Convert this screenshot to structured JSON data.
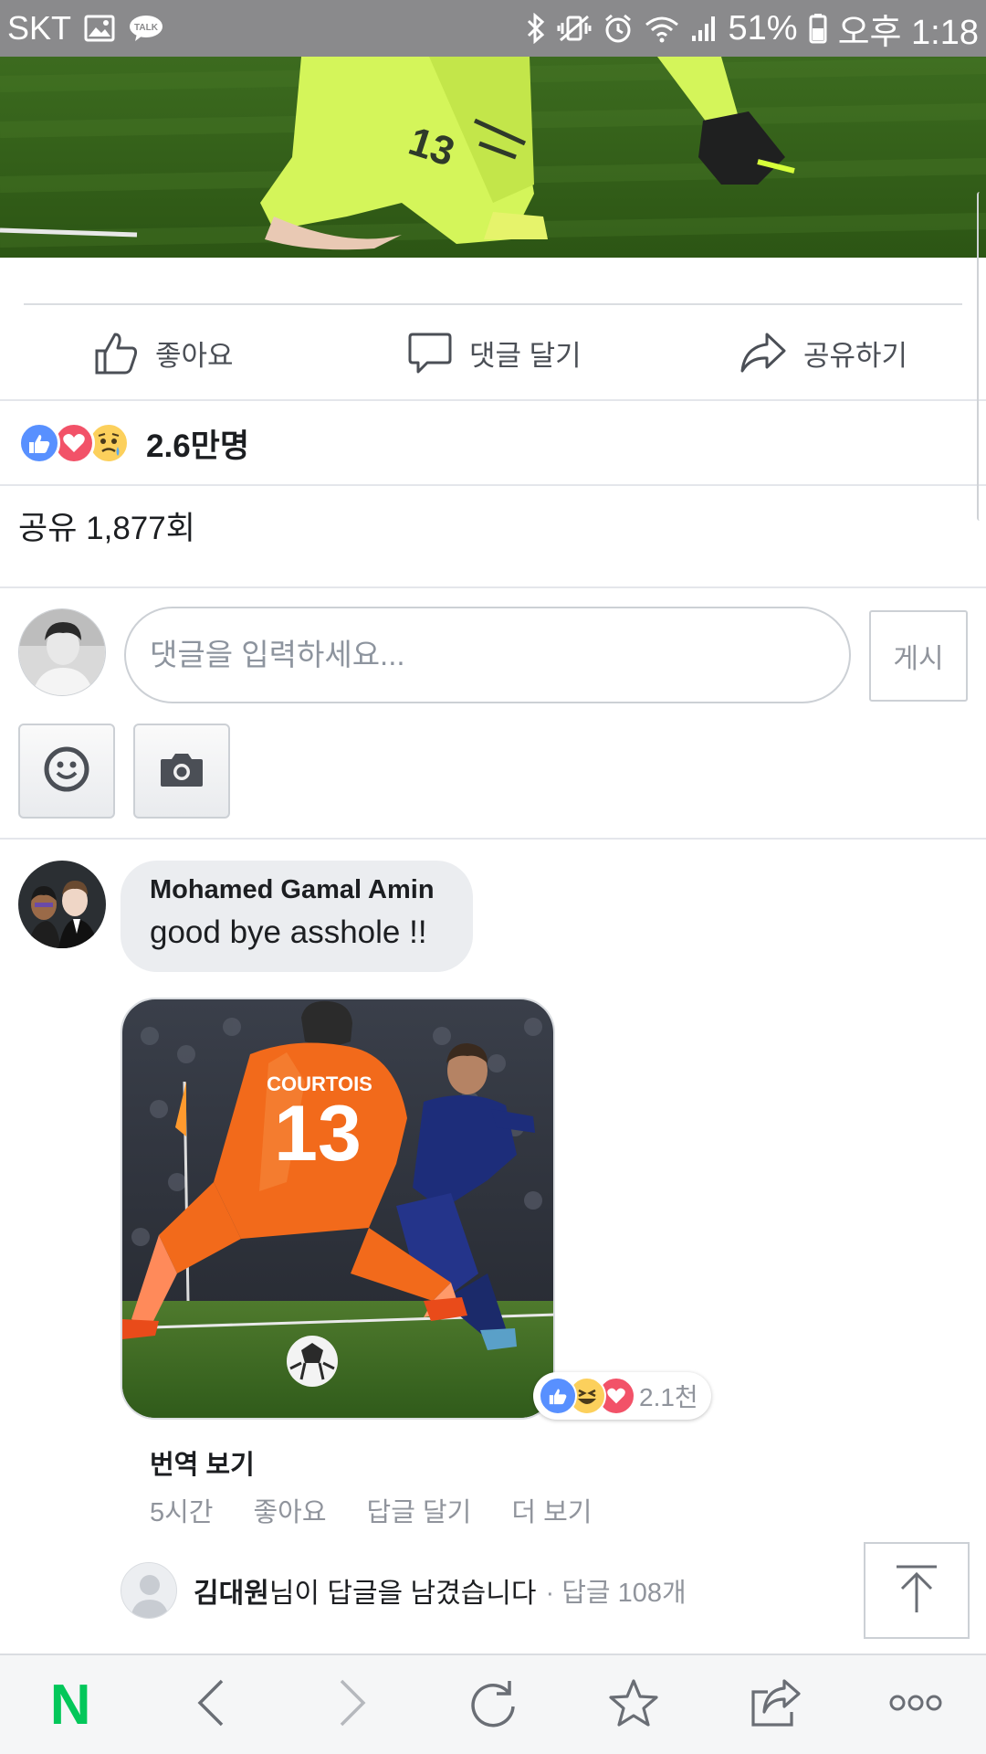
{
  "status_bar": {
    "carrier": "SKT",
    "talk_label": "TALK",
    "battery_percent": "51%",
    "time": "오후 1:18"
  },
  "post": {
    "jersey_number": "13",
    "actions": {
      "like_label": "좋아요",
      "comment_label": "댓글 달기",
      "share_label": "공유하기"
    },
    "reactions": {
      "icons": [
        "like",
        "love",
        "sad"
      ],
      "count": "2.6만명"
    },
    "share_count": "공유 1,877회"
  },
  "composer": {
    "placeholder": "댓글을 입력하세요...",
    "post_button": "게시",
    "emoji_button_icon": "smiley-icon",
    "camera_button_icon": "camera-icon"
  },
  "comment": {
    "author": "Mohamed Gamal Amin",
    "text": "good bye asshole !!",
    "photo": {
      "player_name": "COURTOIS",
      "jersey_number": "13"
    },
    "reactions": {
      "icons": [
        "like",
        "haha",
        "love"
      ],
      "count": "2.1천"
    },
    "translate_label": "번역 보기",
    "time": "5시간",
    "like_label": "좋아요",
    "reply_label": "답글 달기",
    "more_label": "더 보기",
    "reply_summary": {
      "name": "김대원",
      "action": "님이 답글을 남겼습니다",
      "count": "· 답글 108개"
    }
  },
  "colors": {
    "status_bar": "#8a8a8c",
    "like_blue": "#5890ff",
    "love_red": "#f25268",
    "naver_green": "#03c75a",
    "meta_gray": "#90949c"
  },
  "toolbar": {
    "logo": "N",
    "icons": [
      "naver-logo",
      "back-icon",
      "forward-icon",
      "refresh-icon",
      "star-icon",
      "share-icon",
      "more-icon"
    ]
  }
}
